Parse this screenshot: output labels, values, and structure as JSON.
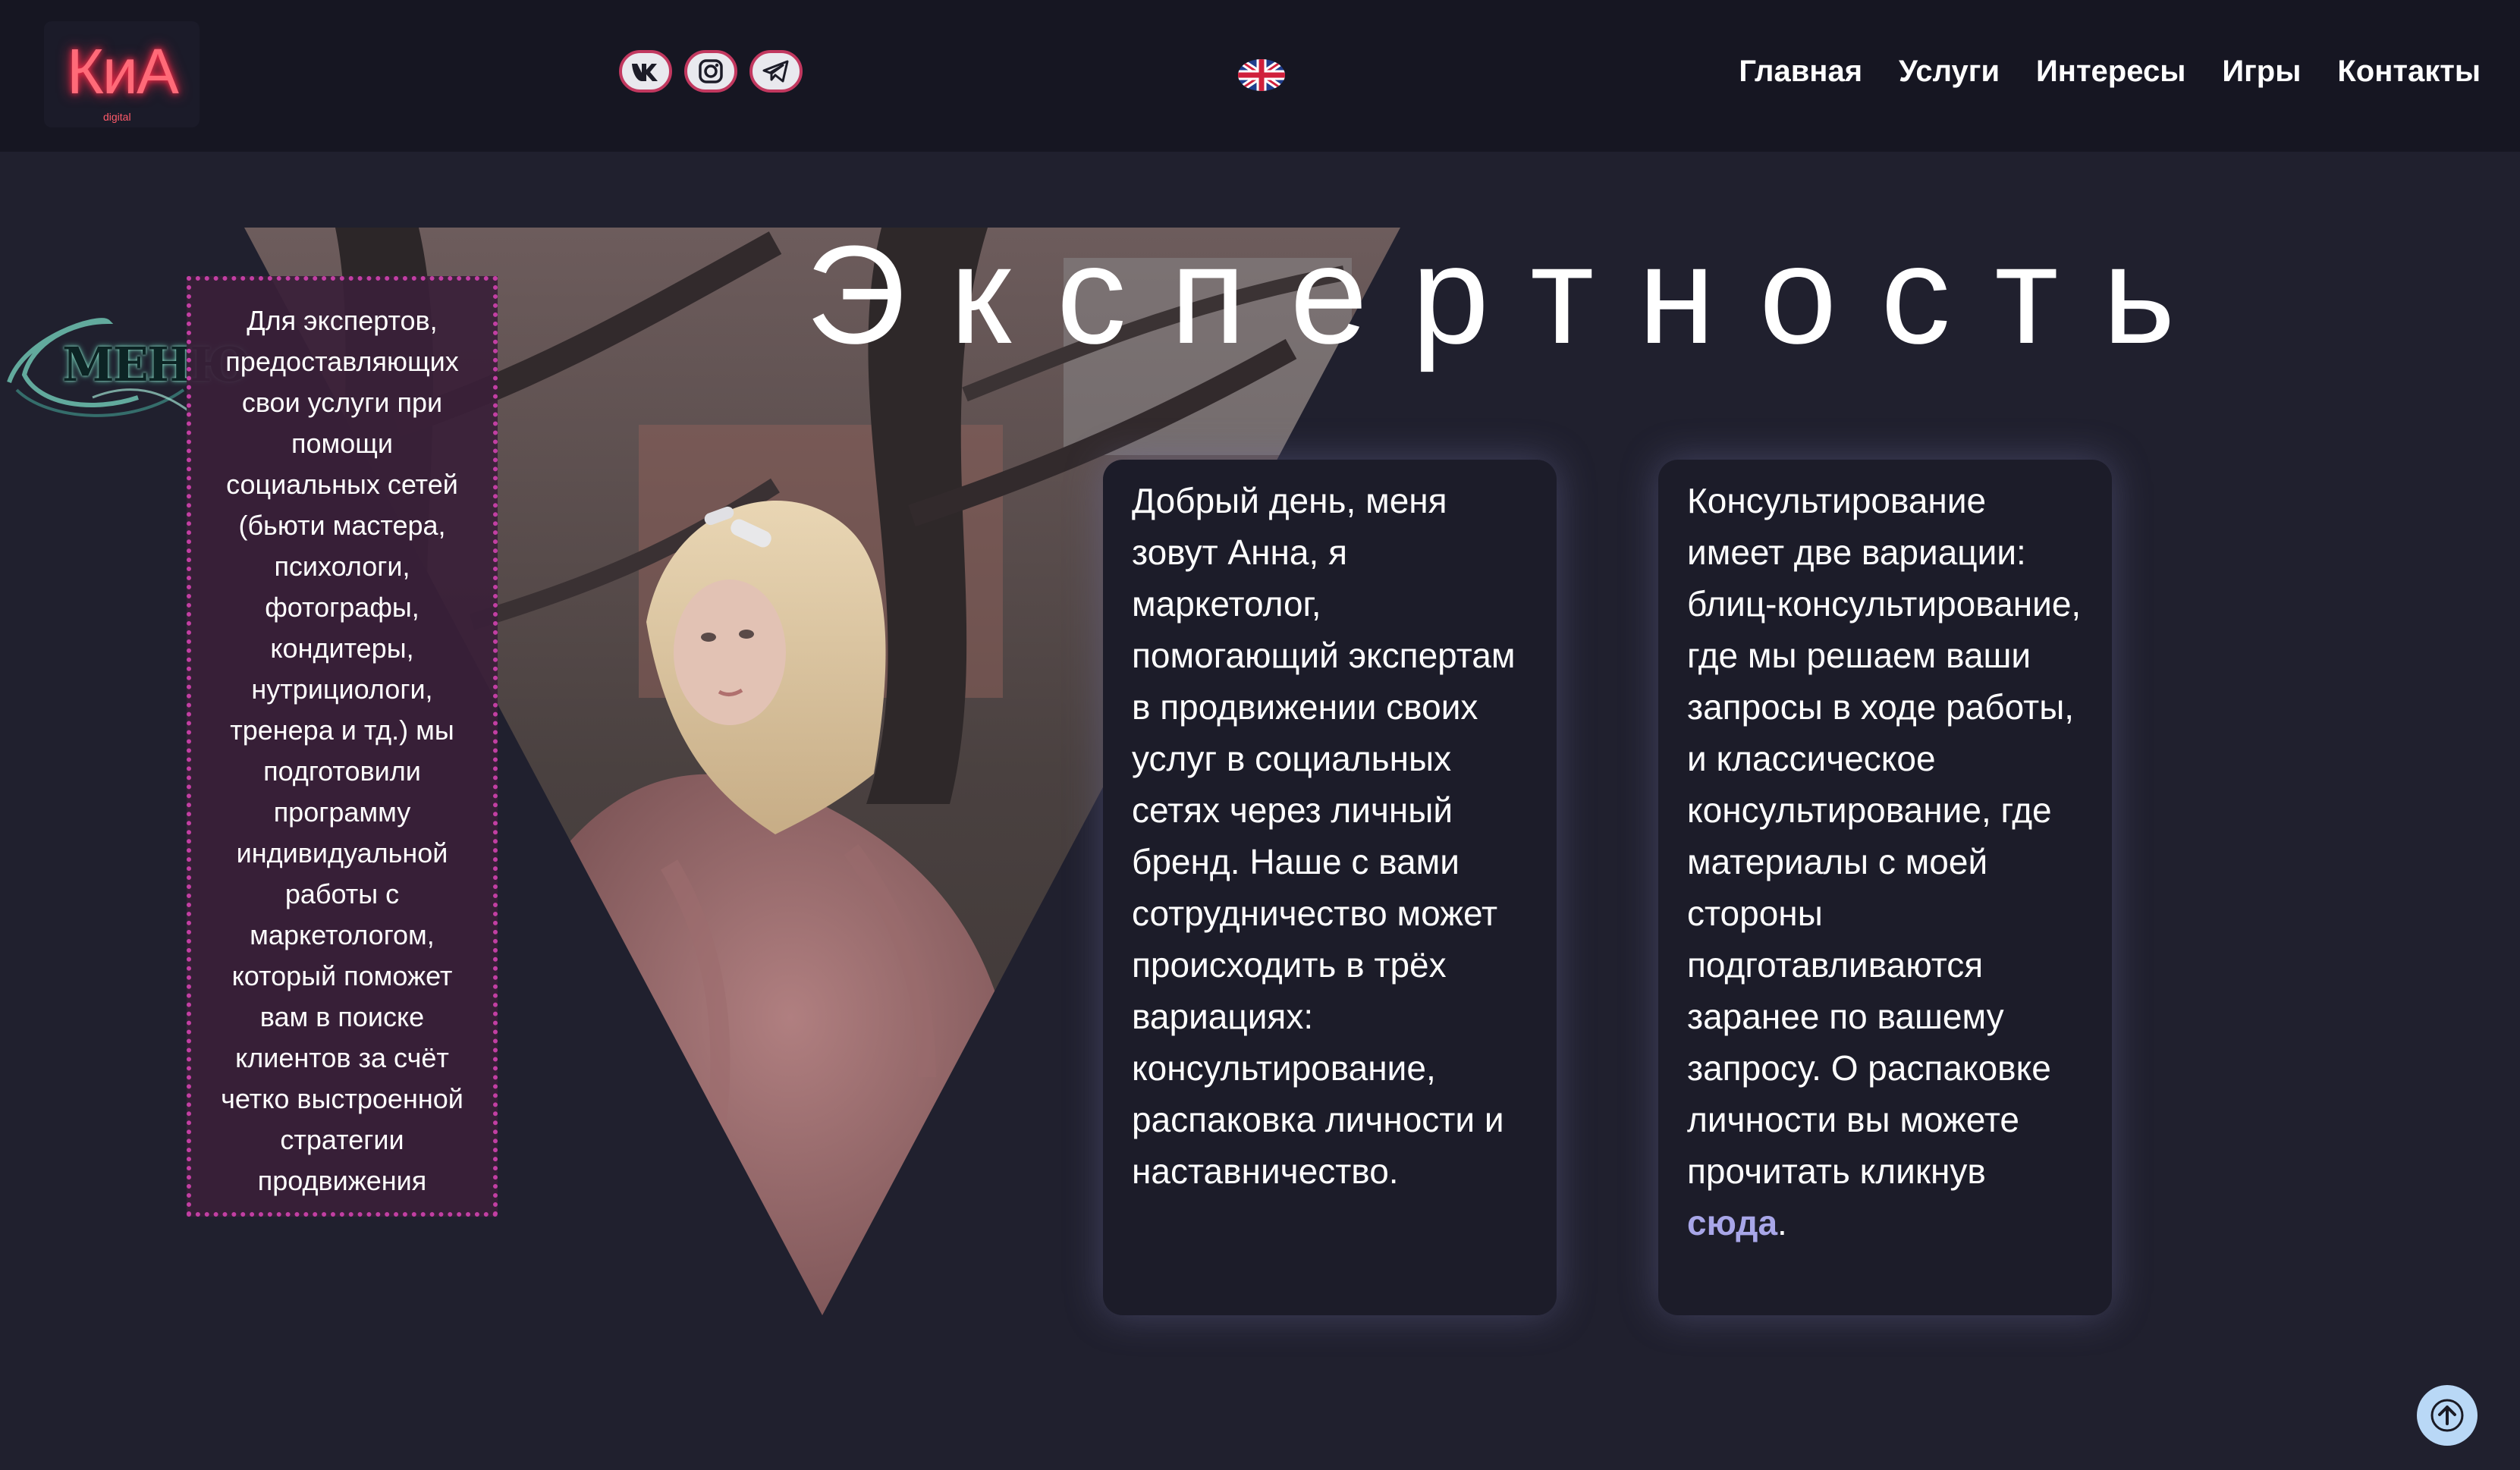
{
  "header": {
    "logo_main": "КиА",
    "logo_sub": "digital",
    "socials": [
      {
        "icon": "vk-icon"
      },
      {
        "icon": "instagram-icon"
      },
      {
        "icon": "telegram-icon"
      }
    ],
    "language_icon": "uk-flag-icon",
    "nav": [
      "Главная",
      "Услуги",
      "Интересы",
      "Игры",
      "Контакты"
    ]
  },
  "hero": {
    "title": "Экспертность",
    "menu_label": "МЕНЮ",
    "intro": "Для экспертов, предоставляющих свои услуги при помощи социальных сетей (бьюти мастера, психологи, фотографы, кондитеры, нутрициологи, тренера и тд.) мы подготовили программу индивидуальной работы с маркетологом, который поможет вам в поиске клиентов за счёт четко выстроенной стратегии продвижения",
    "card1": "Добрый день, меня зовут Анна, я маркетолог, помогающий экспертам в продвижении своих услуг в социальных сетях через личный бренд. Наше с вами сотрудничество может происходить в трёх вариациях: консультирование, распаковка личности и наставничество.",
    "card2": {
      "text": "Консультирование имеет две вариации: блиц-консультирование, где мы решаем ваши запросы в ходе работы, и классическое консультирование, где материалы с моей стороны подготавливаются заранее по вашему запросу. О распаковке личности вы можете прочитать кликнув ",
      "link": "сюда",
      "end": "."
    }
  },
  "scroll_top_icon": "arrow-up-icon",
  "colors": {
    "background": "#20202e",
    "header": "#161622",
    "accent_border": "#c23fa3",
    "link": "#a8a6e8",
    "logo": "#ff6a78"
  }
}
